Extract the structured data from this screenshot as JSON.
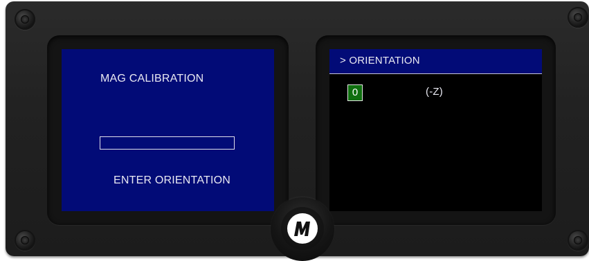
{
  "left_screen": {
    "title": "MAG  CALIBRATION",
    "progress": 0,
    "prompt": "ENTER ORIENTATION"
  },
  "right_screen": {
    "header": "> ORIENTATION",
    "selected_value": "0",
    "axis_label": "(-Z)"
  },
  "knob": {
    "logo_letter": "M"
  },
  "colors": {
    "screen_blue": "#020b77",
    "selection_green": "#0f6f0f",
    "panel": "#222222"
  }
}
